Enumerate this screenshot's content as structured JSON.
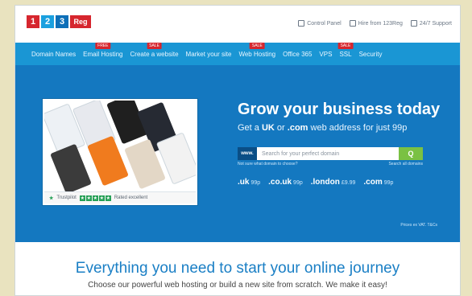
{
  "brand": {
    "logo_digits": [
      "1",
      "2",
      "3"
    ],
    "logo_suffix": "Reg",
    "colors": {
      "red": "#d6262e",
      "light_blue": "#1aa0df",
      "mid_blue": "#0d6fb8",
      "nav": "#1a96d4",
      "hero": "#1478c0",
      "green": "#7ac143"
    }
  },
  "top_links": [
    {
      "icon": "lock-icon",
      "label": "Control Panel"
    },
    {
      "icon": "phone-icon",
      "label": "Hire from 123Reg"
    },
    {
      "icon": "support-icon",
      "label": "24/7 Support"
    }
  ],
  "nav": {
    "items": [
      {
        "label": "Domain Names",
        "badge": ""
      },
      {
        "label": "Email Hosting",
        "badge": "FREE"
      },
      {
        "label": "Create a website",
        "badge": "SALE"
      },
      {
        "label": "Market your site",
        "badge": ""
      },
      {
        "label": "Web Hosting",
        "badge": "SALE"
      },
      {
        "label": "Office 365",
        "badge": ""
      },
      {
        "label": "VPS",
        "badge": ""
      },
      {
        "label": "SSL",
        "badge": "SALE"
      },
      {
        "label": "Security",
        "badge": ""
      }
    ]
  },
  "hero": {
    "title": "Grow your business today",
    "sub_pre": "Get a ",
    "sub_uk": "UK",
    "sub_mid": " or ",
    "sub_com": ".com",
    "sub_post": " web address for just 99p",
    "search": {
      "prefix": "www.",
      "placeholder": "Search for your perfect domain",
      "button": "Q"
    },
    "search_link_left": "Not sure what domain to choose?",
    "search_link_right": "Search all domains",
    "prices": [
      {
        "tld": ".uk",
        "price": "99p"
      },
      {
        "tld": ".co.uk",
        "price": "99p"
      },
      {
        "tld": ".london",
        "price": "£9.99"
      },
      {
        "tld": ".com",
        "price": "99p"
      }
    ],
    "footnote": "Prices ex VAT. T&Cs",
    "trustpilot": {
      "label": "Trustpilot",
      "rating_text": "Rated excellent"
    }
  },
  "content": {
    "heading": "Everything you need to start your online journey",
    "subheading": "Choose our powerful web hosting or build a new site from scratch. We make it easy!"
  }
}
